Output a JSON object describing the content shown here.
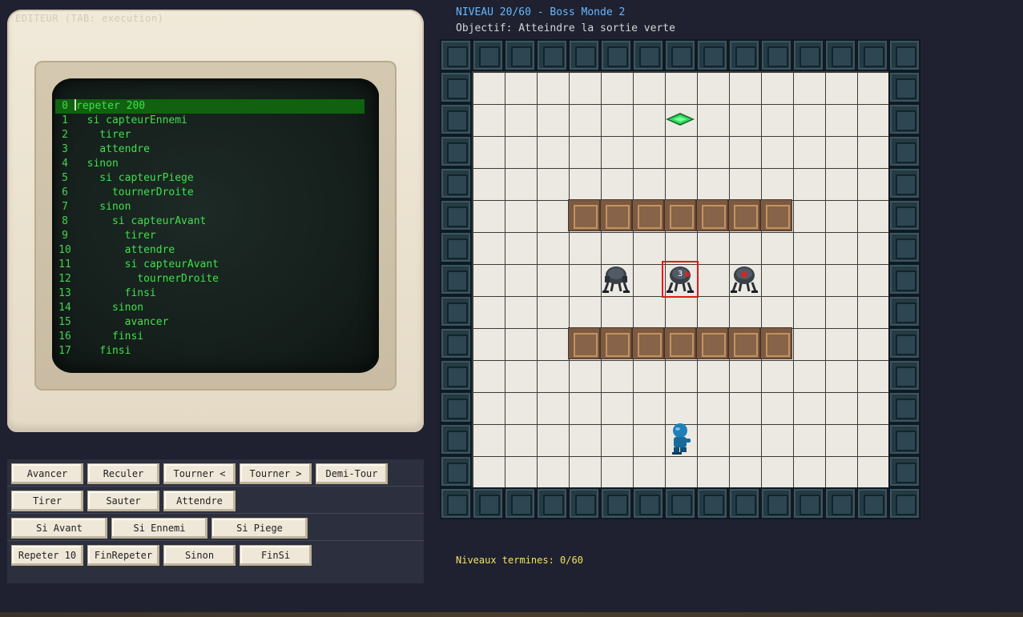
{
  "monitor": {
    "caption": "EDITEUR (TAB: execution)",
    "code_lines": [
      {
        "n": "0",
        "text": "repeter 200",
        "active": true
      },
      {
        "n": "1",
        "text": "  si capteurEnnemi"
      },
      {
        "n": "2",
        "text": "    tirer"
      },
      {
        "n": "3",
        "text": "    attendre"
      },
      {
        "n": "4",
        "text": "  sinon"
      },
      {
        "n": "5",
        "text": "    si capteurPiege"
      },
      {
        "n": "6",
        "text": "      tournerDroite"
      },
      {
        "n": "7",
        "text": "    sinon"
      },
      {
        "n": "8",
        "text": "      si capteurAvant"
      },
      {
        "n": "9",
        "text": "        tirer"
      },
      {
        "n": "10",
        "text": "        attendre"
      },
      {
        "n": "11",
        "text": "        si capteurAvant"
      },
      {
        "n": "12",
        "text": "          tournerDroite"
      },
      {
        "n": "13",
        "text": "        finsi"
      },
      {
        "n": "14",
        "text": "      sinon"
      },
      {
        "n": "15",
        "text": "        avancer"
      },
      {
        "n": "16",
        "text": "      finsi"
      },
      {
        "n": "17",
        "text": "    finsi"
      }
    ]
  },
  "commands": {
    "row1": [
      "Avancer",
      "Reculer",
      "Tourner <",
      "Tourner >",
      "Demi-Tour"
    ],
    "row2": [
      "Tirer",
      "Sauter",
      "Attendre"
    ],
    "row3": [
      "Si Avant",
      "Si Ennemi",
      "Si Piege"
    ],
    "row4": [
      "Repeter 10",
      "FinRepeter",
      "Sinon",
      "FinSi"
    ]
  },
  "hud": {
    "level": "NIVEAU 20/60 - Boss Monde 2",
    "objective": "Objectif: Atteindre la sortie verte",
    "completed": "Niveaux termines: 0/60"
  },
  "board": {
    "boss_hp": "3",
    "colors": {
      "exit": "#2fe05a",
      "enemy_eye": "#e02020",
      "player": "#1f7fb8",
      "target": "#e11b1b"
    }
  }
}
